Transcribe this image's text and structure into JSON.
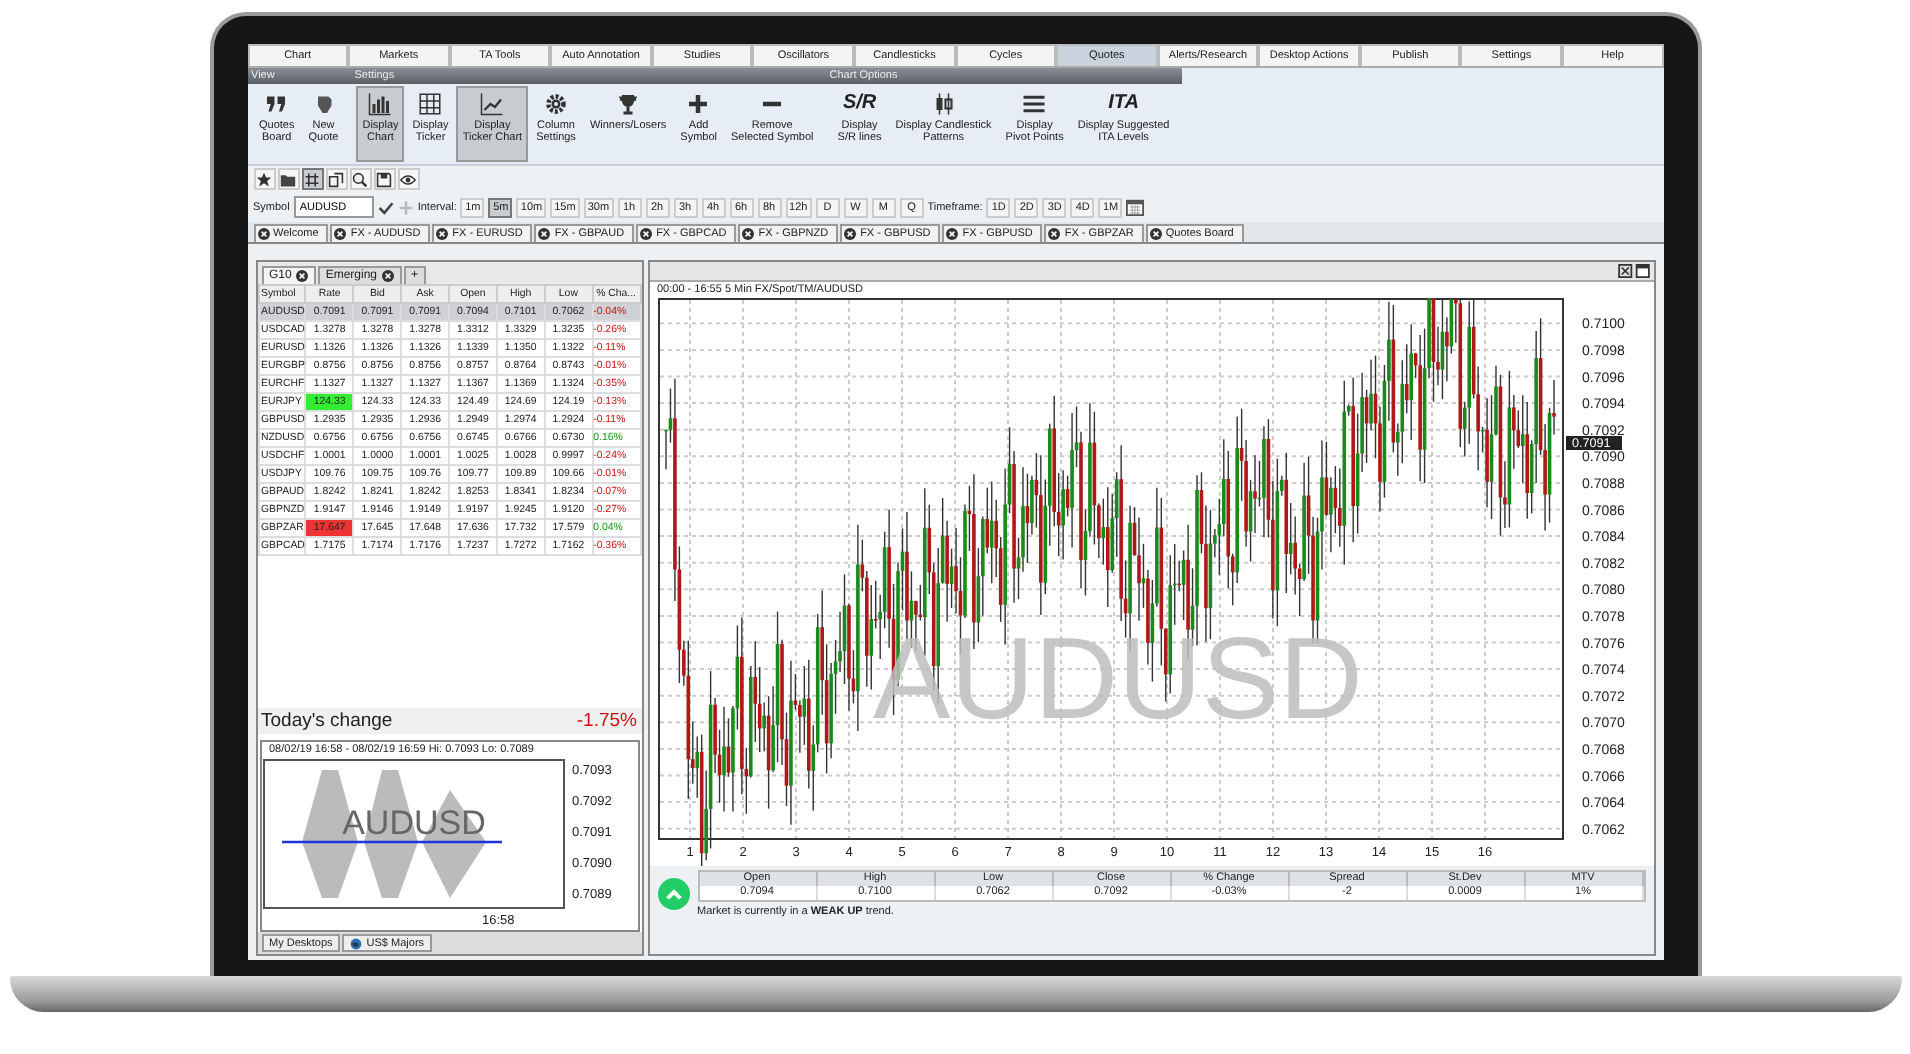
{
  "menu_tabs": [
    {
      "label": "Chart",
      "selected": false
    },
    {
      "label": "Markets",
      "selected": false
    },
    {
      "label": "TA Tools",
      "selected": false
    },
    {
      "label": "Auto Annotation",
      "selected": false
    },
    {
      "label": "Studies",
      "selected": false
    },
    {
      "label": "Oscillators",
      "selected": false
    },
    {
      "label": "Candlesticks",
      "selected": false
    },
    {
      "label": "Cycles",
      "selected": false
    },
    {
      "label": "Quotes",
      "selected": true
    },
    {
      "label": "Alerts/Research",
      "selected": false
    },
    {
      "label": "Desktop Actions",
      "selected": false
    },
    {
      "label": "Publish",
      "selected": false
    },
    {
      "label": "Settings",
      "selected": false
    },
    {
      "label": "Help",
      "selected": false
    }
  ],
  "ribbon": [
    {
      "title": "View",
      "buttons": [
        {
          "label": "Quotes\nBoard",
          "selected": false
        },
        {
          "label": "New\nQuote",
          "selected": false
        }
      ]
    },
    {
      "title": "Settings",
      "buttons": [
        {
          "label": "Display\nChart",
          "selected": true
        },
        {
          "label": "Display\nTicker",
          "selected": false
        },
        {
          "label": "Display\nTicker Chart",
          "selected": true
        },
        {
          "label": "Column\nSettings",
          "selected": false
        },
        {
          "label": "Winners/Losers",
          "selected": false
        },
        {
          "label": "Add\nSymbol",
          "selected": false
        },
        {
          "label": "Remove\nSelected Symbol",
          "selected": false
        }
      ]
    },
    {
      "title": "Chart Options",
      "buttons": [
        {
          "label": "Display\nS/R lines",
          "icon_text": "S/R",
          "selected": false
        },
        {
          "label": "Display Candlestick\nPatterns",
          "selected": false
        },
        {
          "label": "Display\nPivot Points",
          "selected": false
        },
        {
          "label": "Display Suggested\nITA Levels",
          "icon_text": "ITA",
          "selected": false
        }
      ]
    }
  ],
  "toolbar": [
    {
      "selected": false
    },
    {
      "selected": false
    },
    {
      "selected": true
    },
    {
      "selected": false
    },
    {
      "selected": false
    },
    {
      "selected": false
    },
    {
      "selected": false
    }
  ],
  "symbol_bar": {
    "symbol_label": "Symbol",
    "symbol": "AUDUSD",
    "interval_label": "Interval:",
    "intervals": [
      {
        "label": "1m",
        "selected": false
      },
      {
        "label": "5m",
        "selected": true
      },
      {
        "label": "10m",
        "selected": false
      },
      {
        "label": "15m",
        "selected": false
      },
      {
        "label": "30m",
        "selected": false
      },
      {
        "label": "1h",
        "selected": false
      },
      {
        "label": "2h",
        "selected": false
      },
      {
        "label": "3h",
        "selected": false
      },
      {
        "label": "4h",
        "selected": false
      },
      {
        "label": "6h",
        "selected": false
      },
      {
        "label": "8h",
        "selected": false
      },
      {
        "label": "12h",
        "selected": false
      },
      {
        "label": "D",
        "selected": false
      },
      {
        "label": "W",
        "selected": false
      },
      {
        "label": "M",
        "selected": false
      },
      {
        "label": "Q",
        "selected": false
      }
    ],
    "timeframe_label": "Timeframe:",
    "timeframes": [
      "1D",
      "2D",
      "3D",
      "4D",
      "1M"
    ]
  },
  "document_tabs": [
    "Welcome",
    "FX - AUDUSD",
    "FX - EURUSD",
    "FX - GBPAUD",
    "FX - GBPCAD",
    "FX - GBPNZD",
    "FX - GBPUSD",
    "FX - GBPUSD",
    "FX - GBPZAR",
    "Quotes Board"
  ],
  "quotes": {
    "tabs": [
      {
        "label": "G10",
        "selected": true
      },
      {
        "label": "Emerging",
        "selected": false
      }
    ],
    "add_tab": "+",
    "columns": [
      "Symbol",
      "Rate",
      "Bid",
      "Ask",
      "Open",
      "High",
      "Low",
      "% Cha..."
    ],
    "rows": [
      {
        "cells": [
          "AUDUSD",
          "0.7091",
          "0.7091",
          "0.7091",
          "0.7094",
          "0.7101",
          "0.7062",
          "-0.04%"
        ],
        "rising": false,
        "flash_up": false,
        "flash_down": false,
        "selected": true
      },
      {
        "cells": [
          "USDCAD",
          "1.3278",
          "1.3278",
          "1.3278",
          "1.3312",
          "1.3329",
          "1.3235",
          "-0.26%"
        ],
        "rising": false,
        "flash_up": false,
        "flash_down": false,
        "selected": false
      },
      {
        "cells": [
          "EURUSD",
          "1.1326",
          "1.1326",
          "1.1326",
          "1.1339",
          "1.1350",
          "1.1322",
          "-0.11%"
        ],
        "rising": false,
        "flash_up": false,
        "flash_down": false,
        "selected": false
      },
      {
        "cells": [
          "EURGBP",
          "0.8756",
          "0.8756",
          "0.8756",
          "0.8757",
          "0.8764",
          "0.8743",
          "-0.01%"
        ],
        "rising": false,
        "flash_up": false,
        "flash_down": false,
        "selected": false
      },
      {
        "cells": [
          "EURCHF",
          "1.1327",
          "1.1327",
          "1.1327",
          "1.1367",
          "1.1369",
          "1.1324",
          "-0.35%"
        ],
        "rising": false,
        "flash_up": false,
        "flash_down": false,
        "selected": false
      },
      {
        "cells": [
          "EURJPY",
          "124.33",
          "124.33",
          "124.33",
          "124.49",
          "124.69",
          "124.19",
          "-0.13%"
        ],
        "rising": false,
        "flash_up": true,
        "flash_down": false,
        "selected": false
      },
      {
        "cells": [
          "GBPUSD",
          "1.2935",
          "1.2935",
          "1.2936",
          "1.2949",
          "1.2974",
          "1.2924",
          "-0.11%"
        ],
        "rising": false,
        "flash_up": false,
        "flash_down": false,
        "selected": false
      },
      {
        "cells": [
          "NZDUSD",
          "0.6756",
          "0.6756",
          "0.6756",
          "0.6745",
          "0.6766",
          "0.6730",
          "0.16%"
        ],
        "rising": true,
        "flash_up": false,
        "flash_down": false,
        "selected": false
      },
      {
        "cells": [
          "USDCHF",
          "1.0001",
          "1.0000",
          "1.0001",
          "1.0025",
          "1.0028",
          "0.9997",
          "-0.24%"
        ],
        "rising": false,
        "flash_up": false,
        "flash_down": false,
        "selected": false
      },
      {
        "cells": [
          "USDJPY",
          "109.76",
          "109.75",
          "109.76",
          "109.77",
          "109.89",
          "109.66",
          "-0.01%"
        ],
        "rising": false,
        "flash_up": false,
        "flash_down": false,
        "selected": false
      },
      {
        "cells": [
          "GBPAUD",
          "1.8242",
          "1.8241",
          "1.8242",
          "1.8253",
          "1.8341",
          "1.8234",
          "-0.07%"
        ],
        "rising": false,
        "flash_up": false,
        "flash_down": false,
        "selected": false
      },
      {
        "cells": [
          "GBPNZD",
          "1.9147",
          "1.9146",
          "1.9149",
          "1.9197",
          "1.9245",
          "1.9120",
          "-0.27%"
        ],
        "rising": false,
        "flash_up": false,
        "flash_down": false,
        "selected": false
      },
      {
        "cells": [
          "GBPZAR",
          "17.647",
          "17.645",
          "17.648",
          "17.636",
          "17.732",
          "17.579",
          "0.04%"
        ],
        "rising": true,
        "flash_up": false,
        "flash_down": true,
        "selected": false
      },
      {
        "cells": [
          "GBPCAD",
          "1.7175",
          "1.7174",
          "1.7176",
          "1.7237",
          "1.7272",
          "1.7162",
          "-0.36%"
        ],
        "rising": false,
        "flash_up": false,
        "flash_down": false,
        "selected": false
      }
    ],
    "today_label": "Today's change",
    "today_value": "-1.75%"
  },
  "ticker_chart": {
    "header": "08/02/19 16:58 - 08/02/19 16:59 Hi: 0.7093 Lo: 0.7089",
    "watermark": "AUDUSD",
    "y_labels": [
      "0.7093",
      "0.7092",
      "0.7091",
      "0.7090",
      "0.7089"
    ],
    "x_label": "16:58"
  },
  "bottom_tabs": [
    "My Desktops",
    "US$ Majors"
  ],
  "chart": {
    "title": "00:00 - 16:55 5 Min FX/Spot/TM/AUDUSD",
    "watermark": "AUDUSD",
    "y_labels": [
      "0.7100",
      "0.7098",
      "0.7096",
      "0.7094",
      "0.7092",
      "0.7090",
      "0.7088",
      "0.7086",
      "0.7084",
      "0.7082",
      "0.7080",
      "0.7078",
      "0.7076",
      "0.7074",
      "0.7072",
      "0.7070",
      "0.7068",
      "0.7066",
      "0.7064",
      "0.7062"
    ],
    "x_labels": [
      "1",
      "2",
      "3",
      "4",
      "5",
      "6",
      "7",
      "8",
      "9",
      "10",
      "11",
      "12",
      "13",
      "14",
      "15",
      "16"
    ],
    "current_price": "0.7091"
  },
  "stats": {
    "columns": [
      "Open",
      "High",
      "Low",
      "Close",
      "% Change",
      "Spread",
      "St.Dev",
      "MTV"
    ],
    "values": [
      "0.7094",
      "0.7100",
      "0.7062",
      "0.7092",
      "-0.03%",
      "-2",
      "0.0009",
      "1%"
    ],
    "trend_text": "Market is currently in a **WEAK UP** trend."
  }
}
